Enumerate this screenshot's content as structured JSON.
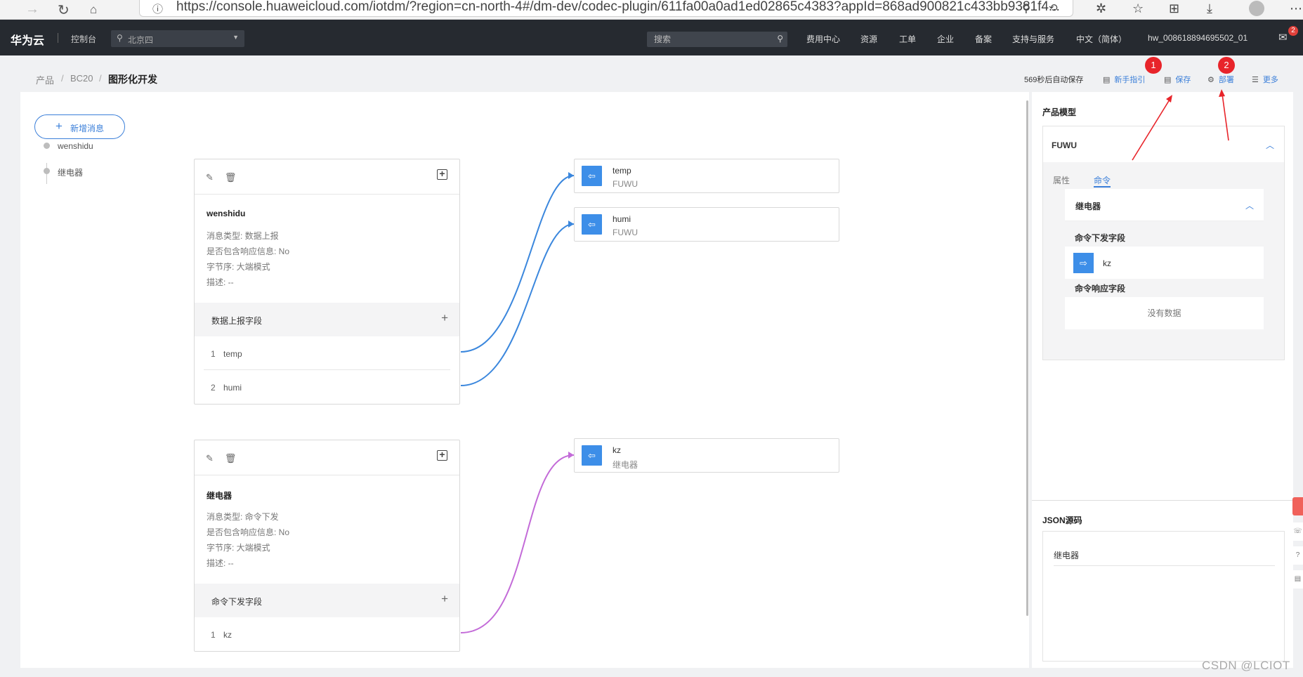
{
  "browser": {
    "url": "https://console.huaweicloud.com/iotdm/?region=cn-north-4#/dm-dev/codec-plugin/611fa00a0ad1ed02865c4383?appId=868ad900821c433bb9381f4..."
  },
  "header": {
    "brand": "华为云",
    "console": "控制台",
    "region": "北京四",
    "search_placeholder": "搜索",
    "nav": [
      "费用中心",
      "资源",
      "工单",
      "企业",
      "备案",
      "支持与服务",
      "中文（简体）",
      "hw_008618894695502_01"
    ],
    "mail_count": "2"
  },
  "breadcrumb": {
    "items": [
      "产品",
      "BC20"
    ],
    "current": "图形化开发"
  },
  "actions": {
    "autosave": "569秒后自动保存",
    "guide": "新手指引",
    "save": "保存",
    "deploy": "部署",
    "more": "更多"
  },
  "annotations": {
    "badge1": "1",
    "badge2": "2"
  },
  "canvas": {
    "add_message": "新增消息",
    "tree": [
      "wenshidu",
      "继电器"
    ],
    "messages": [
      {
        "name": "wenshidu",
        "type": "消息类型: 数据上报",
        "response": "是否包含响应信息: No",
        "endian": "字节序: 大端模式",
        "desc": "描述: --",
        "fields_title": "数据上报字段",
        "fields": [
          {
            "index": "1",
            "name": "temp"
          },
          {
            "index": "2",
            "name": "humi"
          }
        ]
      },
      {
        "name": "继电器",
        "type": "消息类型: 命令下发",
        "response": "是否包含响应信息: No",
        "endian": "字节序: 大端模式",
        "desc": "描述: --",
        "fields_title": "命令下发字段",
        "fields": [
          {
            "index": "1",
            "name": "kz"
          }
        ]
      }
    ],
    "model_targets": [
      {
        "name": "temp",
        "service": "FUWU"
      },
      {
        "name": "humi",
        "service": "FUWU"
      },
      {
        "name": "kz",
        "service": "继电器"
      }
    ],
    "link_colors": {
      "report": "#3b87dd",
      "command": "#c36bd8"
    }
  },
  "model_panel": {
    "title": "产品模型",
    "service": "FUWU",
    "tabs": [
      "属性",
      "命令"
    ],
    "active_tab": "命令",
    "command": "继电器",
    "down_fields_title": "命令下发字段",
    "down_field": "kz",
    "resp_fields_title": "命令响应字段",
    "no_data": "没有数据",
    "json_title": "JSON源码",
    "json_content": "继电器"
  },
  "watermark": "CSDN @LCIOT"
}
